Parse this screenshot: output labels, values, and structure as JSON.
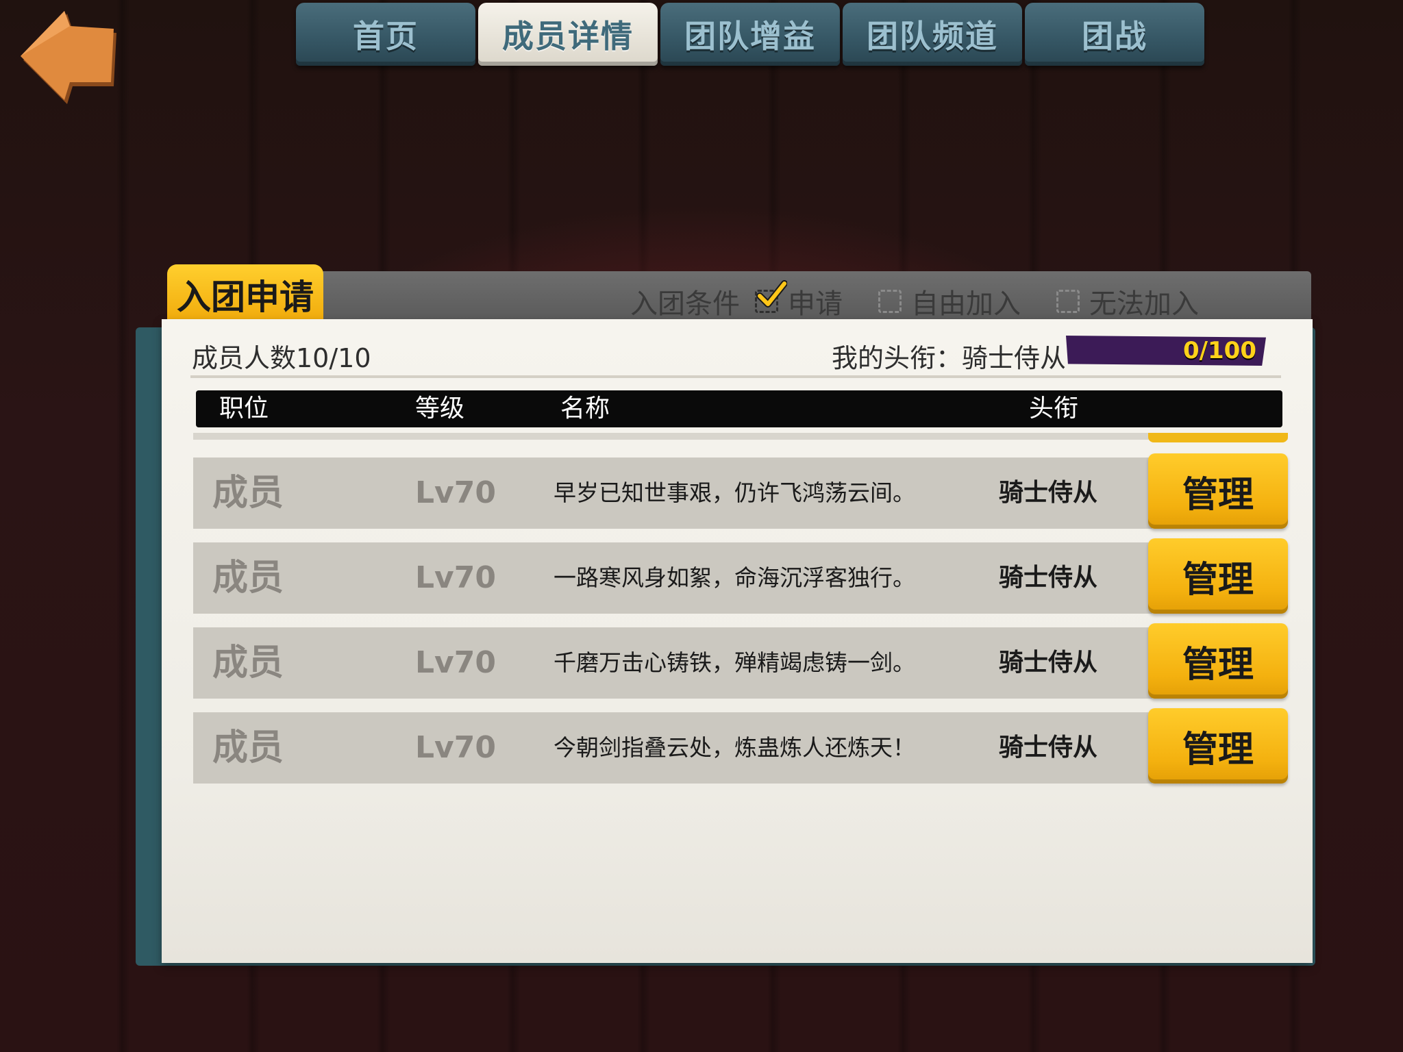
{
  "tabs": [
    {
      "label": "首页",
      "active": false
    },
    {
      "label": "成员详情",
      "active": true
    },
    {
      "label": "团队增益",
      "active": false
    },
    {
      "label": "团队频道",
      "active": false
    },
    {
      "label": "团战",
      "active": false
    }
  ],
  "panel": {
    "tab_label": "入团申请",
    "conditions_label": "入团条件",
    "options": [
      {
        "label": "申请",
        "checked": true
      },
      {
        "label": "自由加入",
        "checked": false
      },
      {
        "label": "无法加入",
        "checked": false
      }
    ],
    "member_count": "成员人数10/10",
    "my_title": "我的头衔：骑士侍从",
    "progress": {
      "text": "0/100",
      "value": 0,
      "max": 100
    }
  },
  "table": {
    "headers": [
      "职位",
      "等级",
      "名称",
      "头衔"
    ],
    "rows": [
      {
        "position": "成员",
        "level": "Lv70",
        "name": "早岁已知世事艰，仍许飞鸿荡云间。",
        "rank": "骑士侍从",
        "action": "管理"
      },
      {
        "position": "成员",
        "level": "Lv70",
        "name": "一路寒风身如絮，命海沉浮客独行。",
        "rank": "骑士侍从",
        "action": "管理"
      },
      {
        "position": "成员",
        "level": "Lv70",
        "name": "千磨万击心铸铁，殚精竭虑铸一剑。",
        "rank": "骑士侍从",
        "action": "管理"
      },
      {
        "position": "成员",
        "level": "Lv70",
        "name": "今朝剑指叠云处，炼蛊炼人还炼天！",
        "rank": "骑士侍从",
        "action": "管理"
      }
    ]
  },
  "icons": {
    "back": "back-arrow-icon",
    "check": "checkmark-icon"
  },
  "colors": {
    "accent": "#f4b10f",
    "tab": "#355664",
    "progress_track": "#3c1b57",
    "progress_text": "#ffd21a"
  }
}
